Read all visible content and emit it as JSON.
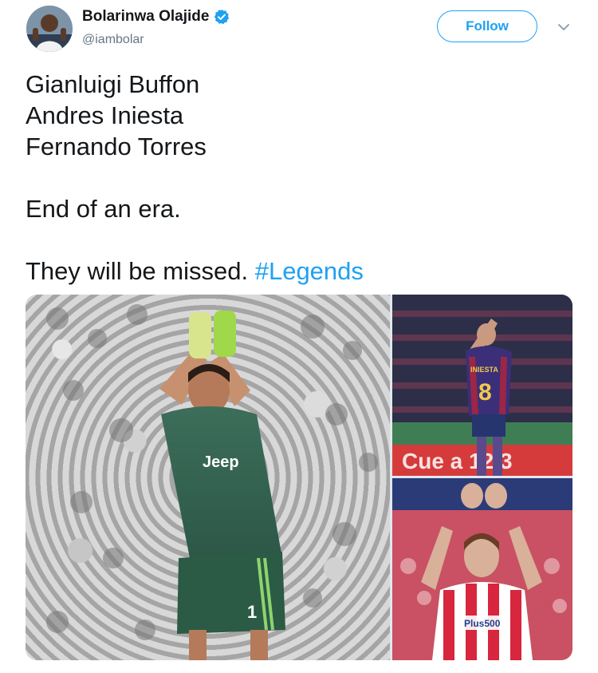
{
  "user": {
    "display_name": "Bolarinwa Olajide",
    "handle": "@iambolar",
    "verified": true,
    "verified_icon": "verified-badge-icon",
    "avatar_icon": "avatar"
  },
  "header": {
    "follow_label": "Follow",
    "more_icon": "chevron-down-icon"
  },
  "tweet": {
    "lines": [
      "Gianluigi Buffon",
      "Andres Iniesta",
      "Fernando Torres"
    ],
    "line_era": "End of an era.",
    "line_missed_prefix": "They will be missed.",
    "hashtag": "#Legends"
  },
  "colors": {
    "accent": "#1da1f2",
    "text": "#14171a",
    "muted": "#657786"
  },
  "media": {
    "images": [
      {
        "name": "media-image-buffon",
        "jersey_text": "Jeep",
        "number": "1"
      },
      {
        "name": "media-image-iniesta",
        "jersey_text": "INIESTA",
        "number": "8",
        "banner_text": "Cue a 12 3"
      },
      {
        "name": "media-image-torres",
        "jersey_text": "Plus500"
      }
    ]
  }
}
